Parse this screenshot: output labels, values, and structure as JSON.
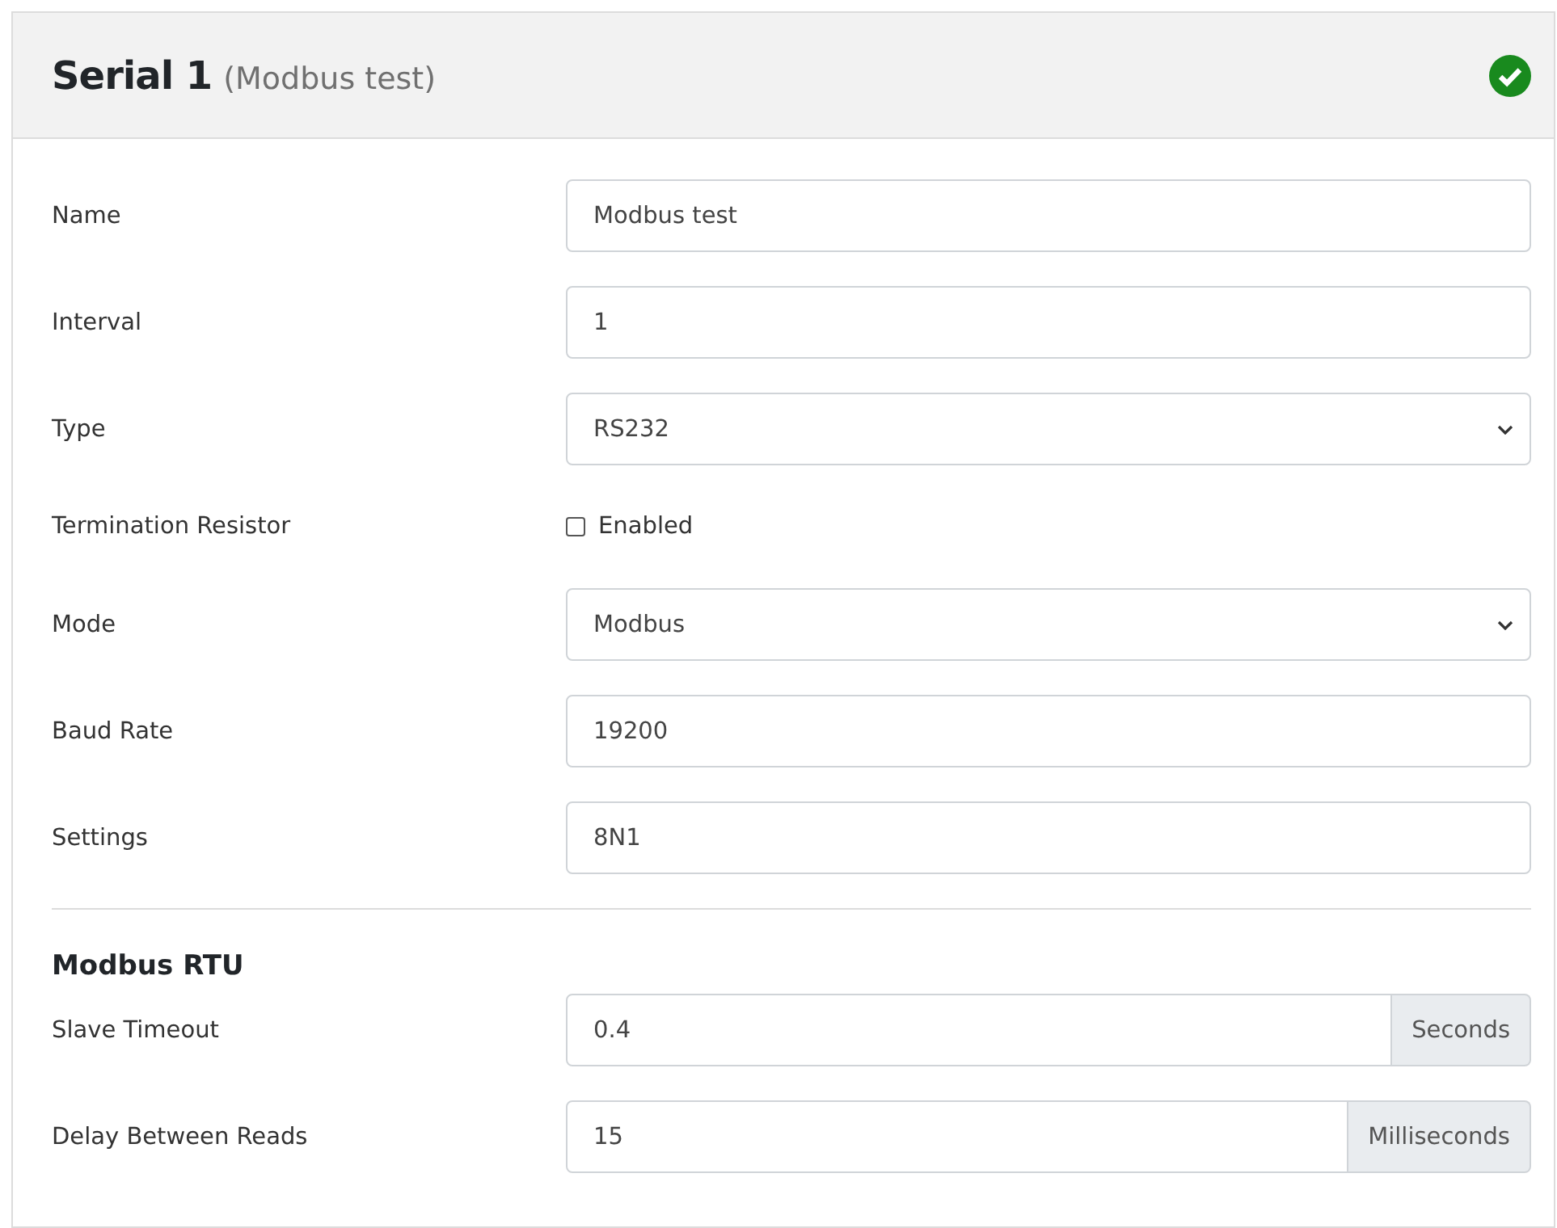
{
  "header": {
    "title": "Serial 1",
    "subtitle": "(Modbus test)",
    "valid": true
  },
  "fields": [
    {
      "kind": "text",
      "label": "Name",
      "value": "Modbus test"
    },
    {
      "kind": "text",
      "label": "Interval",
      "value": "1"
    },
    {
      "kind": "select",
      "label": "Type",
      "value": "RS232"
    },
    {
      "kind": "checkbox",
      "label": "Termination Resistor",
      "option": "Enabled",
      "checked": false
    },
    {
      "kind": "select",
      "label": "Mode",
      "value": "Modbus"
    },
    {
      "kind": "text",
      "label": "Baud Rate",
      "value": "19200"
    },
    {
      "kind": "text",
      "label": "Settings",
      "value": "8N1"
    }
  ],
  "section": {
    "title": "Modbus RTU",
    "fields": [
      {
        "kind": "addon",
        "label": "Slave Timeout",
        "value": "0.4",
        "unit": "Seconds"
      },
      {
        "kind": "addon",
        "label": "Delay Between Reads",
        "value": "15",
        "unit": "Milliseconds"
      }
    ]
  }
}
